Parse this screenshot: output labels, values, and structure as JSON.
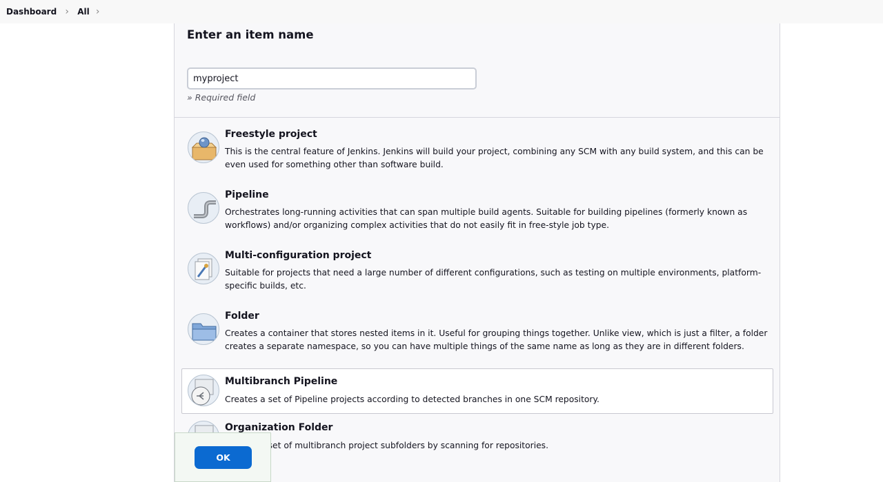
{
  "breadcrumb": {
    "items": [
      "Dashboard",
      "All"
    ],
    "separator": "›"
  },
  "form": {
    "title": "Enter an item name",
    "item_name_value": "myproject",
    "required_note": "» Required field"
  },
  "item_types": [
    {
      "title": "Freestyle project",
      "description": "This is the central feature of Jenkins. Jenkins will build your project, combining any SCM with any build system, and this can be even used for something other than software build.",
      "icon": "freestyle-icon"
    },
    {
      "title": "Pipeline",
      "description": "Orchestrates long-running activities that can span multiple build agents. Suitable for building pipelines (formerly known as workflows) and/or organizing complex activities that do not easily fit in free-style job type.",
      "icon": "pipeline-icon"
    },
    {
      "title": "Multi-configuration project",
      "description": "Suitable for projects that need a large number of different configurations, such as testing on multiple environments, platform-specific builds, etc.",
      "icon": "multi-configuration-icon"
    },
    {
      "title": "Folder",
      "description": "Creates a container that stores nested items in it. Useful for grouping things together. Unlike view, which is just a filter, a folder creates a separate namespace, so you can have multiple things of the same name as long as they are in different folders.",
      "icon": "folder-icon"
    },
    {
      "title": "Multibranch Pipeline",
      "description": "Creates a set of Pipeline projects according to detected branches in one SCM repository.",
      "icon": "multibranch-pipeline-icon"
    },
    {
      "title": "Organization Folder",
      "description": "Creates a set of multibranch project subfolders by scanning for repositories.",
      "icon": "organization-folder-icon"
    }
  ],
  "actions": {
    "ok_label": "OK"
  },
  "colors": {
    "accent": "#0b6ad1",
    "panel_bg": "#f8f8fa",
    "border": "#d6d6dd"
  }
}
